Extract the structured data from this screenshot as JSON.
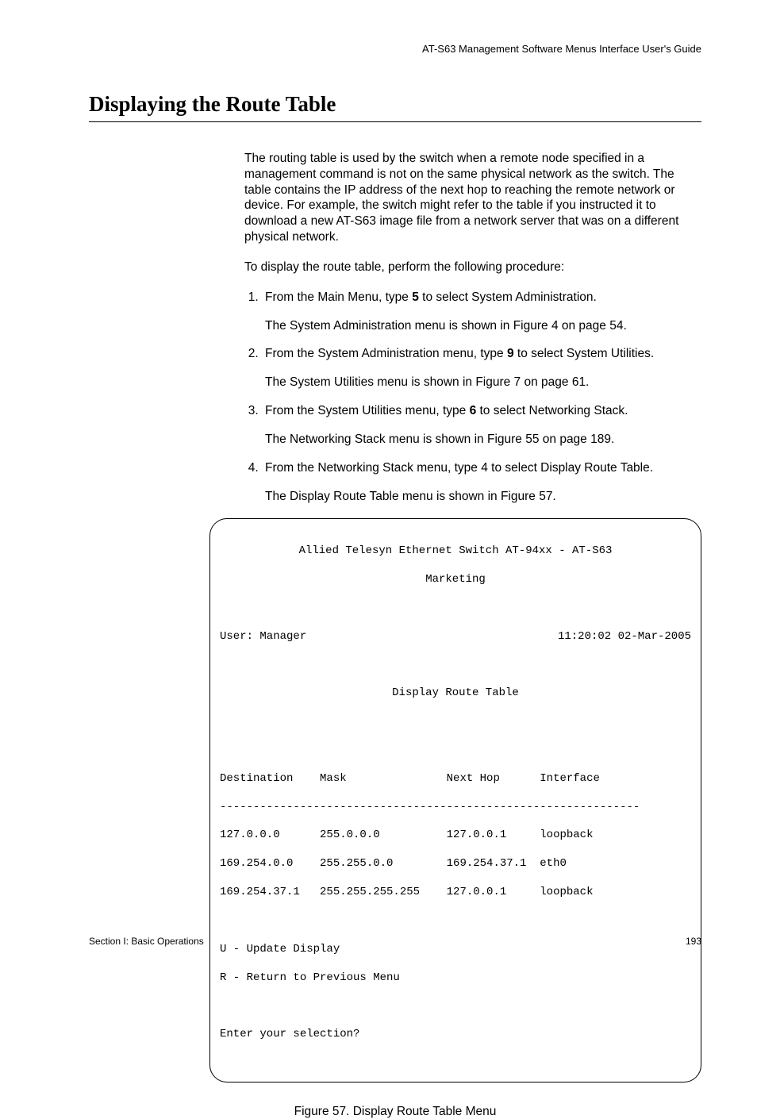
{
  "header": {
    "running": "AT-S63 Management Software Menus Interface User's Guide"
  },
  "title": "Displaying the Route Table",
  "intro": {
    "p1": "The routing table is used by the switch when a remote node specified in a management command is not on the same physical network as the switch. The table contains the IP address of the next hop to reaching the remote network or device. For example, the switch might refer to the table if you instructed it to download a new AT-S63 image file from a network server that was on a different physical network.",
    "p2": "To display the route table, perform the following procedure:"
  },
  "steps": [
    {
      "pre": "From the Main Menu, type ",
      "bold": "5",
      "post": " to select System Administration.",
      "sub": "The System Administration menu is shown in Figure 4 on page 54."
    },
    {
      "pre": "From the System Administration menu, type ",
      "bold": "9",
      "post": " to select System Utilities.",
      "sub": "The System Utilities menu is shown in Figure 7 on page 61."
    },
    {
      "pre": "From the System Utilities menu, type ",
      "bold": "6",
      "post": " to select Networking Stack.",
      "sub": "The Networking Stack menu is shown in Figure 55 on page 189."
    },
    {
      "pre": "From the Networking Stack menu, type 4 to select Display Route Table.",
      "bold": "",
      "post": "",
      "sub": "The Display Route Table menu is shown in Figure 57."
    }
  ],
  "screen": {
    "title_line1": "Allied Telesyn Ethernet Switch AT-94xx - AT-S63",
    "title_line2": "Marketing",
    "user_label": "User: Manager",
    "timestamp": "11:20:02 02-Mar-2005",
    "menu_title": "Display Route Table",
    "columns": "Destination    Mask               Next Hop      Interface",
    "divider": "---------------------------------------------------------------",
    "rows": [
      "127.0.0.0      255.0.0.0          127.0.0.1     loopback",
      "169.254.0.0    255.255.0.0        169.254.37.1  eth0",
      "169.254.37.1   255.255.255.255    127.0.0.1     loopback"
    ],
    "route_rows": [
      {
        "destination": "127.0.0.0",
        "mask": "255.0.0.0",
        "next_hop": "127.0.0.1",
        "interface": "loopback"
      },
      {
        "destination": "169.254.0.0",
        "mask": "255.255.0.0",
        "next_hop": "169.254.37.1",
        "interface": "eth0"
      },
      {
        "destination": "169.254.37.1",
        "mask": "255.255.255.255",
        "next_hop": "127.0.0.1",
        "interface": "loopback"
      }
    ],
    "opt_u": "U - Update Display",
    "opt_r": "R - Return to Previous Menu",
    "prompt": "Enter your selection?"
  },
  "caption": "Figure 57. Display Route Table Menu",
  "footer": {
    "left": "Section I: Basic Operations",
    "right": "193"
  }
}
